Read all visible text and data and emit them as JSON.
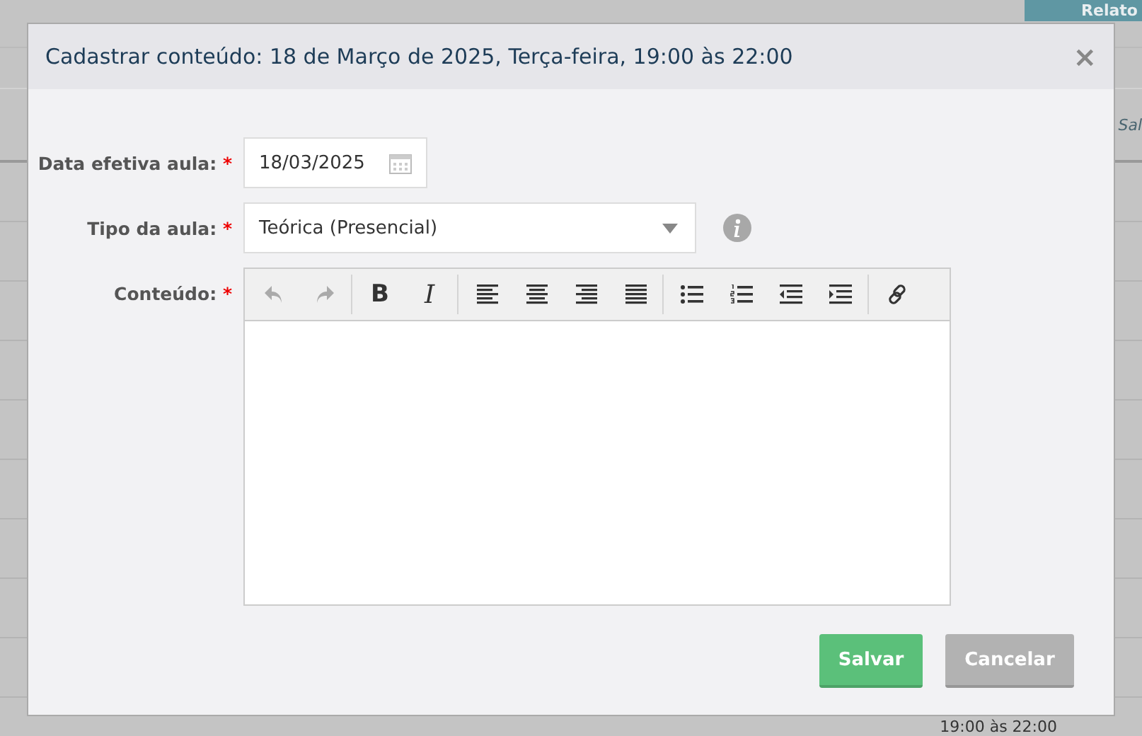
{
  "background": {
    "report_button": "Relato",
    "column_text": "Sal",
    "time_text": "19:00 às 22:00"
  },
  "modal": {
    "title": "Cadastrar conteúdo: 18 de Março de 2025, Terça-feira, 19:00 às 22:00",
    "close": "×",
    "fields": [
      {
        "kind": "date",
        "label": "Data efetiva aula:",
        "required_mark": "*",
        "value": "18/03/2025"
      },
      {
        "kind": "select",
        "label": "Tipo da aula:",
        "required_mark": "*",
        "value": "Teórica (Presencial)",
        "info": true
      },
      {
        "kind": "editor",
        "label": "Conteúdo:",
        "required_mark": "*"
      }
    ],
    "toolbar": [
      [
        {
          "kind": "undo",
          "disabled": true
        },
        {
          "kind": "redo",
          "disabled": true
        }
      ],
      [
        {
          "kind": "bold",
          "label": "B",
          "disabled": false
        },
        {
          "kind": "italic",
          "label": "I",
          "disabled": false
        }
      ],
      [
        {
          "kind": "align-left",
          "disabled": false
        },
        {
          "kind": "align-center",
          "disabled": false
        },
        {
          "kind": "align-right",
          "disabled": false
        },
        {
          "kind": "justify",
          "disabled": false
        }
      ],
      [
        {
          "kind": "bullets",
          "disabled": false
        },
        {
          "kind": "numbers",
          "disabled": false
        },
        {
          "kind": "outdent",
          "disabled": false
        },
        {
          "kind": "indent",
          "disabled": false
        }
      ],
      [
        {
          "kind": "link",
          "disabled": false
        }
      ]
    ],
    "buttons": [
      {
        "kind": "primary",
        "label": "Salvar"
      },
      {
        "kind": "secondary",
        "label": "Cancelar"
      }
    ]
  }
}
